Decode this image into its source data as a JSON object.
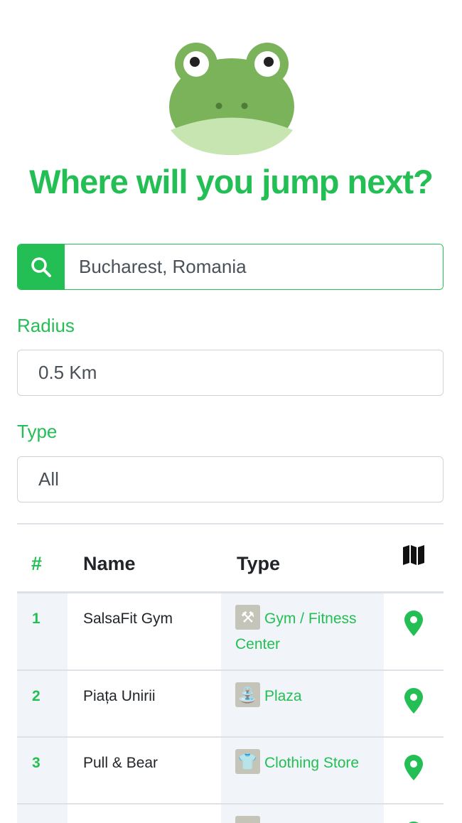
{
  "header": {
    "headline": "Where will you jump next?"
  },
  "search": {
    "value": "Bucharest, Romania"
  },
  "radius": {
    "label": "Radius",
    "value": "0.5 Km"
  },
  "type_filter": {
    "label": "Type",
    "value": "All"
  },
  "table": {
    "headers": {
      "num": "#",
      "name": "Name",
      "type": "Type"
    },
    "rows": [
      {
        "num": "1",
        "name": "SalsaFit Gym",
        "type": "Gym / Fitness Center",
        "icon": "dumbbell-icon"
      },
      {
        "num": "2",
        "name": "Piața Unirii",
        "type": "Plaza",
        "icon": "fountain-icon"
      },
      {
        "num": "3",
        "name": "Pull & Bear",
        "type": "Clothing Store",
        "icon": "tshirt-icon"
      },
      {
        "num": "",
        "name": "",
        "type": "",
        "icon": "place-icon"
      }
    ]
  },
  "colors": {
    "accent": "#23bf55",
    "frog_body": "#7ab35a",
    "frog_belly": "#c6e5b0"
  }
}
